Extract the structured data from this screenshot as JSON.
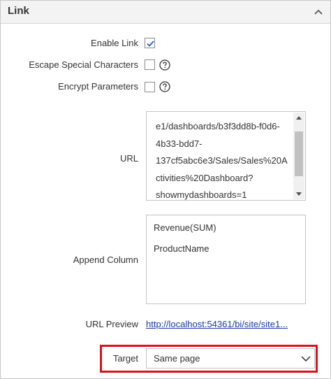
{
  "panel": {
    "title": "Link"
  },
  "enable_link": {
    "label": "Enable Link",
    "checked": true
  },
  "escape_special": {
    "label": "Escape Special Characters",
    "checked": false
  },
  "encrypt_params": {
    "label": "Encrypt Parameters",
    "checked": false
  },
  "url": {
    "label": "URL",
    "lines": [
      "e1/dashboards/b3f3dd8b-f0d6-",
      "4b33-bdd7-",
      "137cf5abc6e3/Sales/Sales%20A",
      "ctivities%20Dashboard?",
      "showmydashboards=1"
    ]
  },
  "append_column": {
    "label": "Append Column",
    "items": [
      "Revenue(SUM)",
      "ProductName"
    ]
  },
  "url_preview": {
    "label": "URL Preview",
    "link": "http://localhost:54361/bi/site/site1..."
  },
  "target": {
    "label": "Target",
    "value": "Same page"
  },
  "icons": {
    "collapse": "chevron-up-icon",
    "help": "question-circle-icon",
    "check": "checkmark-icon"
  },
  "colors": {
    "highlight": "#e0101a",
    "link": "#1a3aa8",
    "check": "#1f5fbf"
  }
}
